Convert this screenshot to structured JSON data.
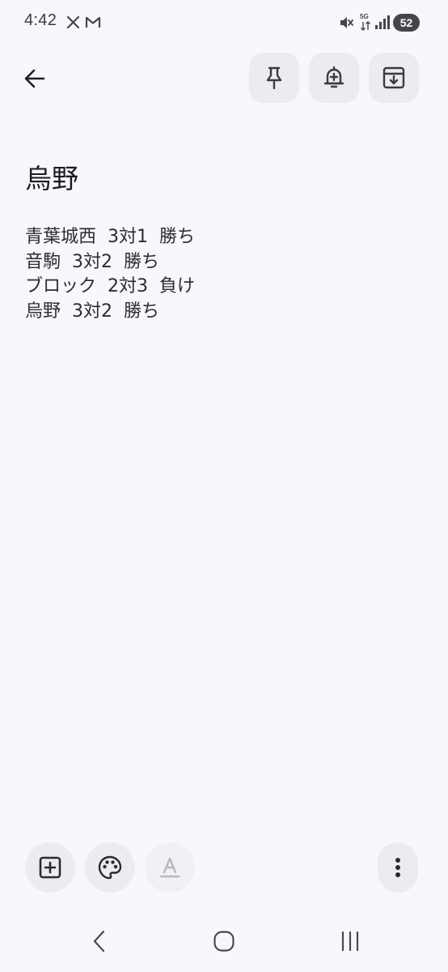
{
  "status_bar": {
    "time": "4:42",
    "notification_icons": [
      "x-icon",
      "gmail-icon"
    ],
    "system_icons": [
      "mute-icon",
      "5g-icon",
      "signal-icon"
    ],
    "network_label": "5G",
    "battery_level": "52"
  },
  "app_bar": {
    "back_icon": "arrow-left-icon",
    "actions": [
      {
        "name": "pin",
        "icon": "pin-icon"
      },
      {
        "name": "reminder",
        "icon": "bell-plus-icon"
      },
      {
        "name": "archive",
        "icon": "archive-icon"
      }
    ]
  },
  "note": {
    "title": "烏野",
    "lines": [
      "青葉城西  3対1  勝ち",
      "音駒  3対2  勝ち",
      "ブロック  2対3  負け",
      "烏野  3対2  勝ち"
    ]
  },
  "bottom_toolbar": {
    "buttons": [
      {
        "name": "add",
        "icon": "add-box-icon",
        "enabled": true
      },
      {
        "name": "color",
        "icon": "palette-icon",
        "enabled": true
      },
      {
        "name": "text-format",
        "icon": "text-format-icon",
        "label": "A",
        "enabled": false
      }
    ],
    "more_icon": "more-vert-icon"
  },
  "system_nav": {
    "buttons": [
      "recents-back-icon",
      "home-icon",
      "recents-icon"
    ]
  }
}
